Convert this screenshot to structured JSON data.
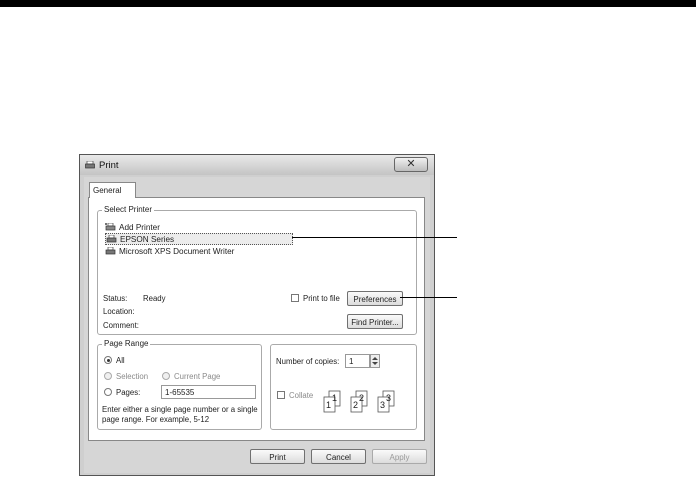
{
  "window": {
    "title": "Print",
    "close_glyph": "✕"
  },
  "tabs": [
    {
      "label": "General"
    }
  ],
  "select_printer": {
    "legend": "Select Printer",
    "items": [
      {
        "label": "Add Printer",
        "icon": "add-printer-icon"
      },
      {
        "label": "EPSON Series",
        "icon": "printer-icon",
        "selected": true
      },
      {
        "label": "Microsoft XPS Document Writer",
        "icon": "printer-icon"
      }
    ],
    "status_label": "Status:",
    "status_value": "Ready",
    "location_label": "Location:",
    "comment_label": "Comment:",
    "print_to_file_label": "Print to file",
    "preferences_button": "Preferences",
    "find_printer_button": "Find Printer..."
  },
  "page_range": {
    "legend": "Page Range",
    "all_label": "All",
    "selection_label": "Selection",
    "current_page_label": "Current Page",
    "pages_label": "Pages:",
    "pages_value": "1-65535",
    "hint_line1": "Enter either a single page number or a single",
    "hint_line2": "page range.  For example, 5-12"
  },
  "copies": {
    "number_label": "Number of copies:",
    "number_value": "1",
    "collate_label": "Collate",
    "collate_pages": [
      {
        "back": "1",
        "front": "1"
      },
      {
        "back": "2",
        "front": "2"
      },
      {
        "back": "3",
        "front": "3"
      }
    ]
  },
  "footer": {
    "print_button": "Print",
    "cancel_button": "Cancel",
    "apply_button": "Apply"
  }
}
